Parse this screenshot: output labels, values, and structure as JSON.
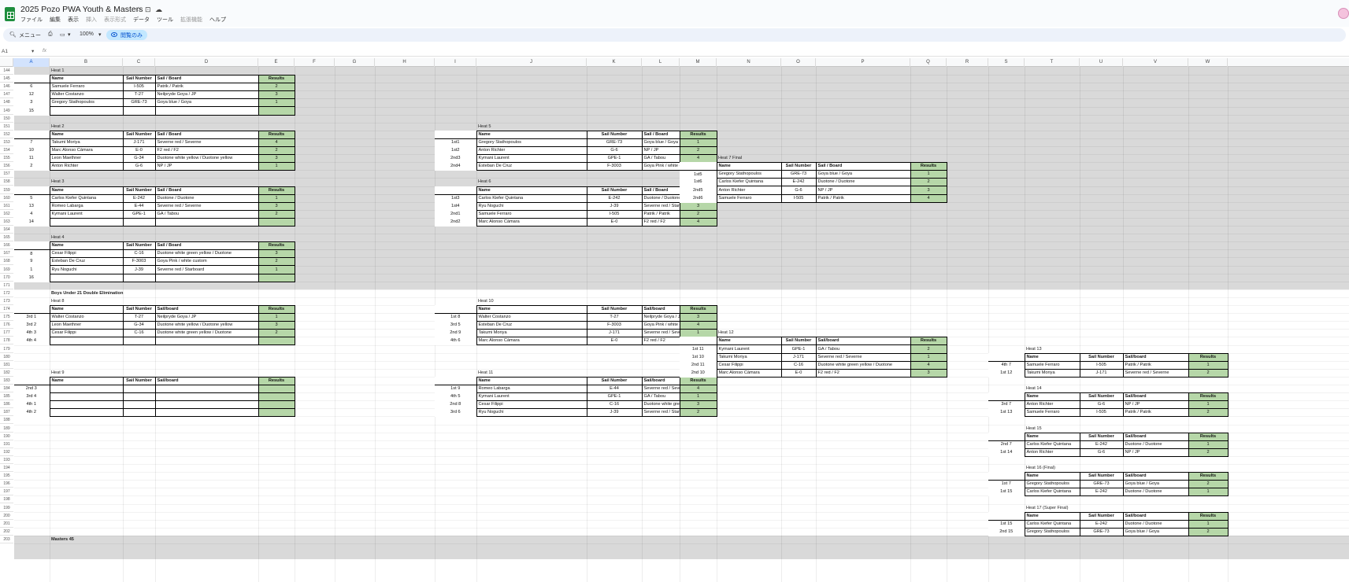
{
  "doc": {
    "title": "2025 Pozo PWA Youth & Masters",
    "menu": [
      "ファイル",
      "編集",
      "表示",
      "挿入",
      "表示形式",
      "データ",
      "ツール",
      "拡張機能",
      "ヘルプ"
    ]
  },
  "toolbar": {
    "menu_search": "メニュー",
    "zoom": "100%",
    "view_only": "閲覧のみ"
  },
  "formula": {
    "cell_ref": "A1",
    "fx": "fx",
    "value": ""
  },
  "columns": [
    "A",
    "B",
    "C",
    "D",
    "E",
    "F",
    "G",
    "H",
    "I",
    "J",
    "K",
    "L",
    "M",
    "N",
    "O",
    "P",
    "Q",
    "R",
    "S",
    "T",
    "U",
    "V",
    "W"
  ],
  "selected_column": "A",
  "row_numbers": [
    "144",
    "145",
    "146",
    "147",
    "148",
    "149",
    "150",
    "151",
    "152",
    "153",
    "154",
    "155",
    "156",
    "157",
    "158",
    "159",
    "160",
    "161",
    "162",
    "163",
    "164",
    "165",
    "166",
    "167",
    "168",
    "169",
    "170",
    "171",
    "172",
    "173",
    "174",
    "175",
    "176",
    "177",
    "178",
    "179",
    "180",
    "181",
    "182",
    "183",
    "184",
    "185",
    "186",
    "187",
    "188",
    "189",
    "190",
    "191",
    "192",
    "193",
    "194",
    "195",
    "196",
    "197",
    "198",
    "199",
    "200",
    "201",
    "202",
    "203"
  ],
  "header_labels": {
    "name": "Name",
    "sail": "Sail Number",
    "board": "Sail / Board",
    "board_lc": "Sail/board",
    "results": "Results"
  },
  "section_labels": [
    "Boys Under 21 Double Elimination",
    "Masters 45"
  ],
  "heats": [
    {
      "title": "Heat 1",
      "board_header": "board",
      "rows": [
        {
          "pos": "6",
          "name": "Samuele Ferraro",
          "sail": "I-505",
          "board": "Patrik / Patrik",
          "res": "2"
        },
        {
          "pos": "12",
          "name": "Walter Costanzo",
          "sail": "T-27",
          "board": "Neilpryde Goya / JP",
          "res": "3"
        },
        {
          "pos": "3",
          "name": "Gregory Stathopoulos",
          "sail": "GRE-73",
          "board": "Goya blue / Goya",
          "res": "1"
        },
        {
          "pos": "15",
          "name": "",
          "sail": "",
          "board": "",
          "res": ""
        }
      ]
    },
    {
      "title": "Heat 2",
      "board_header": "board",
      "rows": [
        {
          "pos": "7",
          "name": "Takumi Moriya",
          "sail": "J-171",
          "board": "Severne red / Severne",
          "res": "4"
        },
        {
          "pos": "10",
          "name": "Marc Alonso Cámara",
          "sail": "E-0",
          "board": "F2 red / F2",
          "res": "2"
        },
        {
          "pos": "11",
          "name": "Leon Maethner",
          "sail": "G-34",
          "board": "Duotone white yellow / Duotone yellow",
          "res": "3"
        },
        {
          "pos": "2",
          "name": "Anton Richter",
          "sail": "G-6",
          "board": "NP / JP",
          "res": "1"
        }
      ]
    },
    {
      "title": "Heat 3",
      "board_header": "board",
      "rows": [
        {
          "pos": "5",
          "name": "Carlos Kiefer Quintana",
          "sail": "E-242",
          "board": "Duotone  / Duotone",
          "res": "1"
        },
        {
          "pos": "13",
          "name": "Romeo Labarga",
          "sail": "E-44",
          "board": "Severne red / Severne",
          "res": "3"
        },
        {
          "pos": "4",
          "name": "Kymani Laurent",
          "sail": "GPE-1",
          "board": "GA / Tabou",
          "res": "2"
        },
        {
          "pos": "14",
          "name": "",
          "sail": "",
          "board": "",
          "res": ""
        }
      ]
    },
    {
      "title": "Heat 4",
      "board_header": "board",
      "rows": [
        {
          "pos": "8",
          "name": "Cesar Filippi",
          "sail": "C-16",
          "board": "Duotone white green yellow / Duotone",
          "res": "3"
        },
        {
          "pos": "9",
          "name": "Esteban De Cruz",
          "sail": "F-3003",
          "board": "Goya Pink / white custom",
          "res": "2"
        },
        {
          "pos": "1",
          "name": "Ryu Noguchi",
          "sail": "J-39",
          "board": "Severne red / Starboard",
          "res": "1"
        },
        {
          "pos": "16",
          "name": "",
          "sail": "",
          "board": "",
          "res": ""
        }
      ]
    },
    {
      "title": "Heat 5",
      "board_header": "board",
      "rows": [
        {
          "pos": "1st1",
          "name": "Gregory Stathopoulos",
          "sail": "GRE-73",
          "board": "Goya blue / Goya",
          "res": "1"
        },
        {
          "pos": "1st2",
          "name": "Anton Richter",
          "sail": "G-6",
          "board": "NP / JP",
          "res": "2"
        },
        {
          "pos": "2nd3",
          "name": "Kymani Laurent",
          "sail": "GPE-1",
          "board": "GA / Tabou",
          "res": "4"
        },
        {
          "pos": "2nd4",
          "name": "Esteban De Cruz",
          "sail": "F-3003",
          "board": "Goya Pink / white custom",
          "res": "3"
        }
      ]
    },
    {
      "title": "Heat 6",
      "board_header": "board",
      "rows": [
        {
          "pos": "1st3",
          "name": "Carlos Kiefer Quintana",
          "sail": "E-242",
          "board": "Duotone  / Duotone",
          "res": "1"
        },
        {
          "pos": "1st4",
          "name": "Ryu Noguchi",
          "sail": "J-39",
          "board": "Severne red / Starboard",
          "res": "3"
        },
        {
          "pos": "2nd1",
          "name": "Samuele Ferraro",
          "sail": "I-505",
          "board": "Patrik / Patrik",
          "res": "2"
        },
        {
          "pos": "2nd2",
          "name": "Marc Alonso Cámara",
          "sail": "E-0",
          "board": "F2 red / F2",
          "res": "4"
        }
      ]
    },
    {
      "title": "Heat 7 Final",
      "board_header": "board",
      "rows": [
        {
          "pos": "1st5",
          "name": "Gregory Stathopoulos",
          "sail": "GRE-73",
          "board": "Goya blue / Goya",
          "res": "1"
        },
        {
          "pos": "1st6",
          "name": "Carlos Kiefer Quintana",
          "sail": "E-242",
          "board": "Duotone  / Duotone",
          "res": "2"
        },
        {
          "pos": "2nd5",
          "name": "Anton Richter",
          "sail": "G-6",
          "board": "NP / JP",
          "res": "3"
        },
        {
          "pos": "2nd6",
          "name": "Samuele Ferraro",
          "sail": "I-505",
          "board": "Patrik / Patrik",
          "res": "4"
        }
      ]
    },
    {
      "title": "Heat 8",
      "board_header": "board_lc",
      "rows": [
        {
          "pos": "3rd 1",
          "name": "Walter Costanzo",
          "sail": "T-27",
          "board": "Neilpryde Goya / JP",
          "res": "1"
        },
        {
          "pos": "3rd 2",
          "name": "Leon Maethner",
          "sail": "G-34",
          "board": "Duotone white yellow / Duotone yellow",
          "res": "3"
        },
        {
          "pos": "4th 3",
          "name": "Cesar Filippi",
          "sail": "C-16",
          "board": "Duotone white green yellow / Duotone",
          "res": "2"
        },
        {
          "pos": "4th 4",
          "name": "",
          "sail": "",
          "board": "",
          "res": ""
        }
      ]
    },
    {
      "title": "Heat 9",
      "board_header": "board_lc",
      "rows": [
        {
          "pos": "2nd 3",
          "name": "",
          "sail": "",
          "board": "",
          "res": ""
        },
        {
          "pos": "3rd 4",
          "name": "",
          "sail": "",
          "board": "",
          "res": ""
        },
        {
          "pos": "4th 1",
          "name": "",
          "sail": "",
          "board": "",
          "res": ""
        },
        {
          "pos": "4th 2",
          "name": "",
          "sail": "",
          "board": "",
          "res": ""
        }
      ]
    },
    {
      "title": "Heat 10",
      "board_header": "board_lc",
      "rows": [
        {
          "pos": "1st 8",
          "name": "Walter Costanzo",
          "sail": "T-27",
          "board": "Neilpryde Goya / JP",
          "res": "3"
        },
        {
          "pos": "3rd 5",
          "name": "Esteban De Cruz",
          "sail": "F-3003",
          "board": "Goya Pink / white custom",
          "res": "4"
        },
        {
          "pos": "2nd 9",
          "name": "Takumi Moriya",
          "sail": "J-171",
          "board": "Severne red / Severne",
          "res": "1"
        },
        {
          "pos": "4th 6",
          "name": "Marc Alonso Cámara",
          "sail": "E-0",
          "board": "F2 red / F2",
          "res": "2"
        }
      ]
    },
    {
      "title": "Heat 11",
      "board_header": "board_lc",
      "rows": [
        {
          "pos": "1st 9",
          "name": "Romeo Labarga",
          "sail": "E-44",
          "board": "Severne red / Severne",
          "res": "4"
        },
        {
          "pos": "4th 5",
          "name": "Kymani Laurent",
          "sail": "GPE-1",
          "board": "GA / Tabou",
          "res": "1"
        },
        {
          "pos": "2nd 8",
          "name": "Cesar Filippi",
          "sail": "C-16",
          "board": "Duotone white green yellow / Duotone",
          "res": "3"
        },
        {
          "pos": "3rd 6",
          "name": "Ryu Noguchi",
          "sail": "J-39",
          "board": "Severne red / Starboard",
          "res": "2"
        }
      ]
    },
    {
      "title": "Heat 12",
      "board_header": "board_lc",
      "rows": [
        {
          "pos": "1st 11",
          "name": "Kymani Laurent",
          "sail": "GPE-1",
          "board": "GA / Tabou",
          "res": "2"
        },
        {
          "pos": "1st 10",
          "name": "Takumi Moriya",
          "sail": "J-171",
          "board": "Severne red / Severne",
          "res": "1"
        },
        {
          "pos": "2nd 11",
          "name": "Cesar Filippi",
          "sail": "C-16",
          "board": "Duotone white green yellow / Duotone",
          "res": "4"
        },
        {
          "pos": "2nd 10",
          "name": "Marc Alonso Cámara",
          "sail": "E-0",
          "board": "F2 red / F2",
          "res": "3"
        }
      ]
    },
    {
      "title": "Heat 13",
      "board_header": "board_lc",
      "rows": [
        {
          "pos": "4th 7",
          "name": "Samuele Ferraro",
          "sail": "I-505",
          "board": "Patrik / Patrik",
          "res": "1"
        },
        {
          "pos": "1st 12",
          "name": "Takumi Moriya",
          "sail": "J-171",
          "board": "Severne red / Severne",
          "res": "2"
        }
      ]
    },
    {
      "title": "Heat 14",
      "board_header": "board_lc",
      "rows": [
        {
          "pos": "3rd 7",
          "name": "Anton Richter",
          "sail": "G-6",
          "board": "NP / JP",
          "res": "1"
        },
        {
          "pos": "1st 13",
          "name": "Samuele Ferraro",
          "sail": "I-505",
          "board": "Patrik / Patrik",
          "res": "2"
        }
      ]
    },
    {
      "title": "Heat 15",
      "board_header": "board_lc",
      "rows": [
        {
          "pos": "2nd 7",
          "name": "Carlos Kiefer Quintana",
          "sail": "E-242",
          "board": "Duotone  / Duotone",
          "res": "1"
        },
        {
          "pos": "1st 14",
          "name": "Anton Richter",
          "sail": "G-6",
          "board": "NP / JP",
          "res": "2"
        }
      ]
    },
    {
      "title": "Heat 16 (Final)",
      "board_header": "board_lc",
      "rows": [
        {
          "pos": "1st 7",
          "name": "Gregory Stathopoulos",
          "sail": "GRE-73",
          "board": "Goya blue / Goya",
          "res": "2"
        },
        {
          "pos": "1st 15",
          "name": "Carlos Kiefer Quintana",
          "sail": "E-242",
          "board": "Duotone  / Duotone",
          "res": "1"
        }
      ]
    },
    {
      "title": "Heat 17 (Super Final)",
      "board_header": "board_lc",
      "rows": [
        {
          "pos": "1st 15",
          "name": "Carlos Kiefer Quintana",
          "sail": "E-242",
          "board": "Duotone  / Duotone",
          "res": "1"
        },
        {
          "pos": "2nd 15",
          "name": "Gregory Stathopoulos",
          "sail": "GRE-73",
          "board": "Goya blue / Goya",
          "res": "2"
        }
      ]
    }
  ],
  "colors": {
    "results_green": "#b6d7a8",
    "band_gray": "#d9d9d9",
    "accent_blue": "#0b57d0",
    "sheets_green": "#1e8e3e"
  }
}
